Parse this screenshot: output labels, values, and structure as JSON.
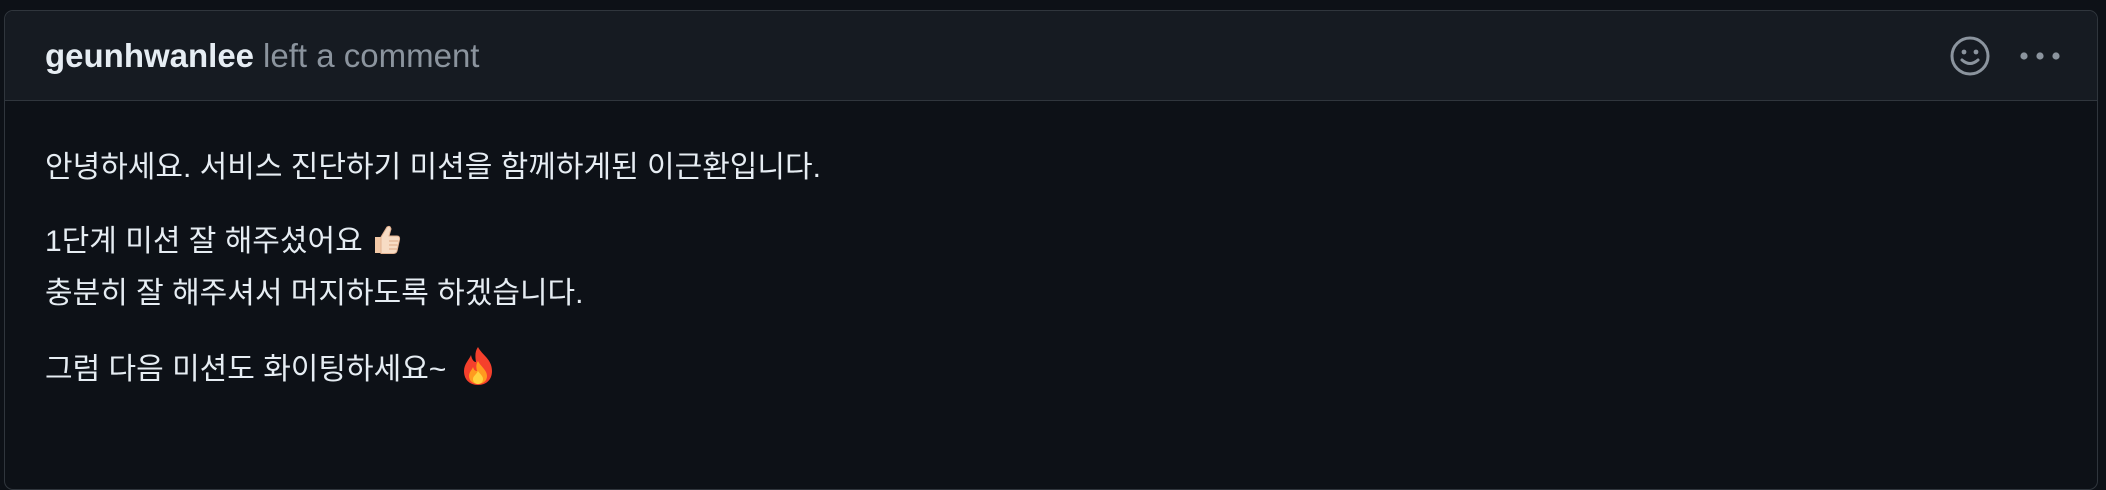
{
  "comment": {
    "author": "geunhwanlee",
    "action_text": "left a comment",
    "paragraphs": [
      {
        "text": "안녕하세요. 서비스 진단하기 미션을 함께하게된 이근환입니다."
      },
      {
        "line1": "1단계 미션 잘 해주셨어요",
        "line1_emoji": "thumbs-up-emoji",
        "line2": "충분히 잘 해주셔서 머지하도록 하겠습니다."
      },
      {
        "text": "그럼 다음 미션도 화이팅하세요~",
        "emoji": "fire-emoji"
      }
    ]
  },
  "header_actions": {
    "reaction_icon": "smiley-icon",
    "menu_icon": "kebab-horizontal-icon"
  },
  "colors": {
    "background": "#0d1117",
    "header_background": "#161b22",
    "border": "#30363d",
    "text": "#e6edf3",
    "muted_text": "#8b949e"
  }
}
